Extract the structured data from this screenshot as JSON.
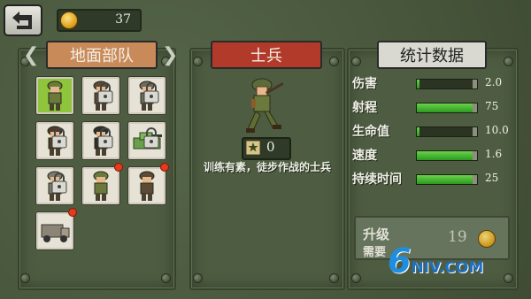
{
  "header": {
    "back_icon": "back-arrow-icon",
    "coins": "37",
    "coin_icon": "gold-coin-icon"
  },
  "left_panel": {
    "tab_label": "地面部队",
    "tab_color": "#c98a5a",
    "units": [
      {
        "name": "rifleman",
        "selected": true,
        "locked": false,
        "new": false
      },
      {
        "name": "flamethrower",
        "selected": false,
        "locked": true,
        "new": false
      },
      {
        "name": "machinegunner",
        "selected": false,
        "locked": true,
        "new": false
      },
      {
        "name": "sniper",
        "selected": false,
        "locked": true,
        "new": false
      },
      {
        "name": "officer",
        "selected": false,
        "locked": true,
        "new": false
      },
      {
        "name": "tank",
        "selected": false,
        "locked": true,
        "new": false
      },
      {
        "name": "medic",
        "selected": false,
        "locked": true,
        "new": false
      },
      {
        "name": "grenadier",
        "selected": false,
        "locked": false,
        "new": true
      },
      {
        "name": "gunner",
        "selected": false,
        "locked": false,
        "new": true
      },
      {
        "name": "truck",
        "selected": false,
        "locked": false,
        "new": true
      }
    ]
  },
  "center_panel": {
    "tab_label": "士兵",
    "tab_color": "#b23a2a",
    "rank_value": "0",
    "description": "训练有素，徒步作战的士兵"
  },
  "right_panel": {
    "tab_label": "统计数据",
    "tab_color": "#d9d9d2",
    "stats": [
      {
        "label": "伤害",
        "value": "2.0",
        "fill": 0.05
      },
      {
        "label": "射程",
        "value": "75",
        "fill": 0.92
      },
      {
        "label": "生命值",
        "value": "10.0",
        "fill": 0.05
      },
      {
        "label": "速度",
        "value": "1.6",
        "fill": 0.92
      },
      {
        "label": "持续时间",
        "value": "25",
        "fill": 0.92
      }
    ]
  },
  "upgrade": {
    "label_1": "升级",
    "label_2": "需要",
    "cost": "19"
  },
  "watermark": {
    "text_digit": "6",
    "text_rest": "NIV.COM"
  }
}
